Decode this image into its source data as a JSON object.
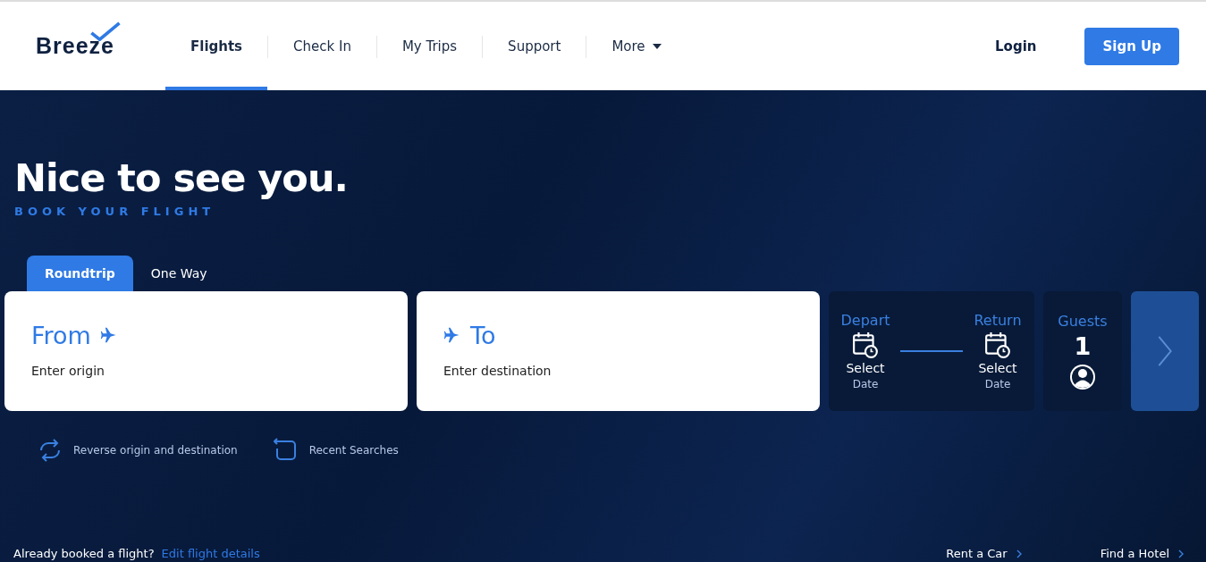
{
  "header": {
    "logo": "Breeze",
    "nav": [
      {
        "label": "Flights",
        "selected": true
      },
      {
        "label": "Check In",
        "selected": false
      },
      {
        "label": "My Trips",
        "selected": false
      },
      {
        "label": "Support",
        "selected": false
      },
      {
        "label": "More",
        "selected": false,
        "kind": "dropdown"
      }
    ],
    "login": "Login",
    "signup": "Sign Up"
  },
  "hero": {
    "title": "Nice to see you.",
    "subtitle": "BOOK YOUR FLIGHT"
  },
  "trip_tabs": [
    {
      "label": "Roundtrip",
      "selected": true
    },
    {
      "label": "One Way",
      "selected": false
    }
  ],
  "origin": {
    "label": "From",
    "placeholder": "Enter origin"
  },
  "destination": {
    "label": "To",
    "placeholder": "Enter destination"
  },
  "dates": [
    {
      "label": "Depart",
      "value": "Select",
      "sub": "Date"
    },
    {
      "label": "Return",
      "value": "Select",
      "sub": "Date"
    }
  ],
  "guests": {
    "label": "Guests",
    "count": "1"
  },
  "actions": [
    {
      "kind": "reverse",
      "label": "Reverse origin and destination"
    },
    {
      "kind": "recent",
      "label": "Recent Searches"
    }
  ],
  "footer": {
    "question": "Already booked a flight?",
    "link": "Edit flight details",
    "links": [
      "Rent a Car",
      "Find a Hotel"
    ]
  }
}
